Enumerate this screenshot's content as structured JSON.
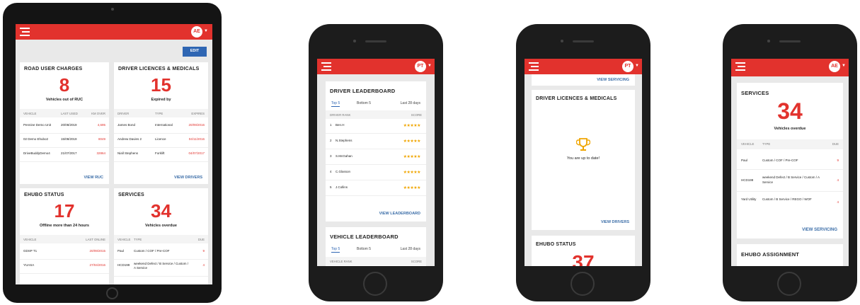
{
  "colors": {
    "brand_red": "#e2322d",
    "link_blue": "#3c6ea8",
    "edit_blue": "#2f66b3",
    "star": "#f0a500"
  },
  "icons": {
    "menu": "menu-icon",
    "avatar": "avatar",
    "chevron": "chevron-down-icon",
    "trophy": "trophy-icon",
    "star": "star-icon"
  },
  "tablet": {
    "avatar": "AE",
    "edit_label": "EDIT",
    "ruc": {
      "title": "ROAD USER CHARGES",
      "value": "8",
      "caption": "Vehicles out of RUC",
      "headers": [
        "VEHICLE",
        "LAST USED",
        "KM OVER"
      ],
      "rows": [
        [
          "Pennine Demo Unit",
          "20/08/2019",
          "4,695"
        ],
        [
          "02 Demo Ehubo2",
          "15/08/2019",
          "8049"
        ],
        [
          "DriveBuddyDemo4",
          "21/07/2017",
          "32864"
        ]
      ],
      "link": "VIEW RUC"
    },
    "licences": {
      "title": "DRIVER LICENCES & MEDICALS",
      "value": "15",
      "caption": "Expired by",
      "headers": [
        "DRIVER",
        "TYPE",
        "EXPIRES"
      ],
      "rows": [
        [
          "James Bond",
          "International",
          "20/09/2016"
        ],
        [
          "Andrew Davies 2",
          "Licence",
          "04/11/2016"
        ],
        [
          "Niall Stephens",
          "Forklift",
          "04/07/2017"
        ]
      ],
      "link": "VIEW DRIVERS"
    },
    "ehubo": {
      "title": "EHUBO STATUS",
      "value": "17",
      "caption": "Offline more than 24 hours",
      "headers": [
        "VEHICLE",
        "LAST ONLINE"
      ],
      "rows": [
        [
          "GDSP T1",
          "20/09/2015"
        ],
        [
          "YUASA",
          "27/04/2016"
        ]
      ]
    },
    "services": {
      "title": "SERVICES",
      "value": "34",
      "caption": "Vehicles overdue",
      "headers": [
        "VEHICLE",
        "TYPE",
        "DUE"
      ],
      "rows": [
        [
          "Paul",
          "Custom / COF / Pre-COF",
          "9"
        ],
        [
          "HCD199",
          "weekend Defect / B Service / Custom / A Service",
          "4"
        ]
      ]
    }
  },
  "phone1": {
    "avatar": "PT",
    "driver_lb": {
      "title": "DRIVER LEADERBOARD",
      "tabs": [
        "Top 5",
        "Bottom 5"
      ],
      "period": "Last 28 days",
      "headers": [
        "DRIVER RANK",
        "SCORE"
      ],
      "rows": [
        [
          "1",
          "Ben.H"
        ],
        [
          "2",
          "N.Stephens"
        ],
        [
          "3",
          "S.McGahan"
        ],
        [
          "4",
          "C.Glasson"
        ],
        [
          "5",
          "J.Collins"
        ]
      ],
      "stars": "★★★★★",
      "link": "VIEW LEADERBOARD"
    },
    "vehicle_lb": {
      "title": "VEHICLE LEADERBOARD",
      "tabs": [
        "Top 5",
        "Bottom 5"
      ],
      "period": "Last 28 days",
      "headers": [
        "VEHICLE RANK",
        "SCORE"
      ]
    }
  },
  "phone2": {
    "avatar": "PT",
    "top_link": "VIEW SERVICING",
    "licences": {
      "title": "DRIVER LICENCES & MEDICALS",
      "message": "You are up to date!",
      "link": "VIEW DRIVERS"
    },
    "ehubo": {
      "title": "EHUBO STATUS",
      "value": "37"
    }
  },
  "phone3": {
    "avatar": "AE",
    "services": {
      "title": "SERVICES",
      "value": "34",
      "caption": "Vehicles overdue",
      "headers": [
        "VEHICLE",
        "TYPE",
        "DUE"
      ],
      "rows": [
        [
          "Paul",
          "Custom / COF / Pre-COF",
          "9"
        ],
        [
          "HCD199",
          "weekend Defect / B Service / Custom / A Service",
          "4"
        ],
        [
          "Yard Utility",
          "Custom / B Service / REGO / WOF",
          "4"
        ]
      ],
      "link": "VIEW SERVICING"
    },
    "assignment": {
      "title": "EHUBO ASSIGNMENT"
    }
  }
}
